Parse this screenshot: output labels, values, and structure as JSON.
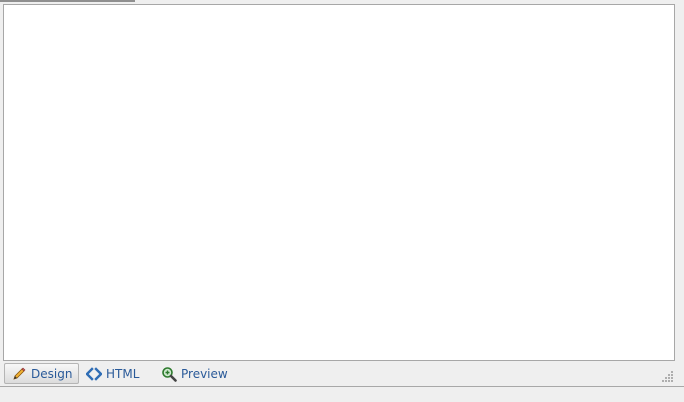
{
  "tabs": {
    "design": {
      "label": "Design",
      "icon": "pencil-icon"
    },
    "html": {
      "label": "HTML",
      "icon": "code-brackets-icon"
    },
    "preview": {
      "label": "Preview",
      "icon": "magnifier-icon"
    }
  },
  "colors": {
    "tab_text": "#2a5a99",
    "editor_bg": "#ffffff",
    "chrome_bg": "#efefef",
    "border": "#a7a7a7"
  }
}
